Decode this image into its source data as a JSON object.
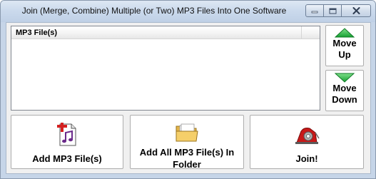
{
  "window": {
    "title": "Join (Merge, Combine) Multiple (or Two) MP3 Files Into One Software",
    "controls": {
      "minimize_icon": "minimize-icon",
      "maximize_icon": "maximize-icon",
      "close_icon": "close-icon"
    }
  },
  "file_list": {
    "column_header": "MP3 File(s)",
    "rows": []
  },
  "side_buttons": {
    "move_up": {
      "line1": "Move",
      "line2": "Up",
      "icon": "arrow-up-icon"
    },
    "move_down": {
      "line1": "Move",
      "line2": "Down",
      "icon": "arrow-down-icon"
    }
  },
  "actions": {
    "add_files": {
      "label": "Add MP3 File(s)",
      "icon": "music-file-add-icon"
    },
    "add_folder": {
      "line1": "Add All MP3 File(s) In",
      "line2": "Folder",
      "icon": "folder-icon"
    },
    "join": {
      "label": "Join!",
      "icon": "tape-dispenser-icon"
    }
  },
  "colors": {
    "arrow_green": "#22a83a",
    "window_frame": "#c6d5e8",
    "client_bg": "#f0f0f0"
  }
}
